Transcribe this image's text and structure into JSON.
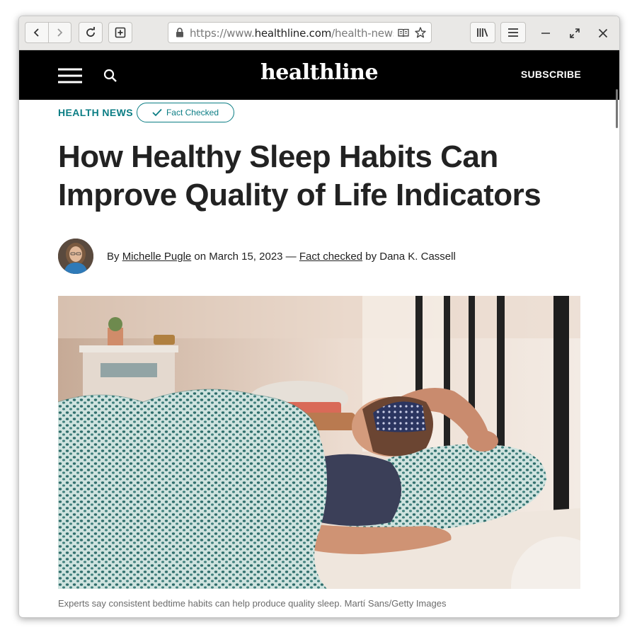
{
  "browser": {
    "url_prefix": "https://www.",
    "url_domain": "healthline.com",
    "url_path": "/health-news"
  },
  "site_header": {
    "logo": "healthline",
    "subscribe_label": "SUBSCRIBE"
  },
  "article": {
    "category": "HEALTH NEWS",
    "fact_badge": "Fact Checked",
    "headline": "How Healthy Sleep Habits Can Improve Quality of Life Indicators",
    "byline": {
      "by": "By",
      "author": "Michelle Pugle",
      "on": "on March 15, 2023 —",
      "fact_checked": "Fact checked",
      "by2": "by Dana K. Cassell"
    },
    "caption": "Experts say consistent bedtime habits can help produce quality sleep. Martí Sans/Getty Images"
  },
  "colors": {
    "accent": "#0b7d84",
    "header_bg": "#000000",
    "text": "#222222"
  }
}
